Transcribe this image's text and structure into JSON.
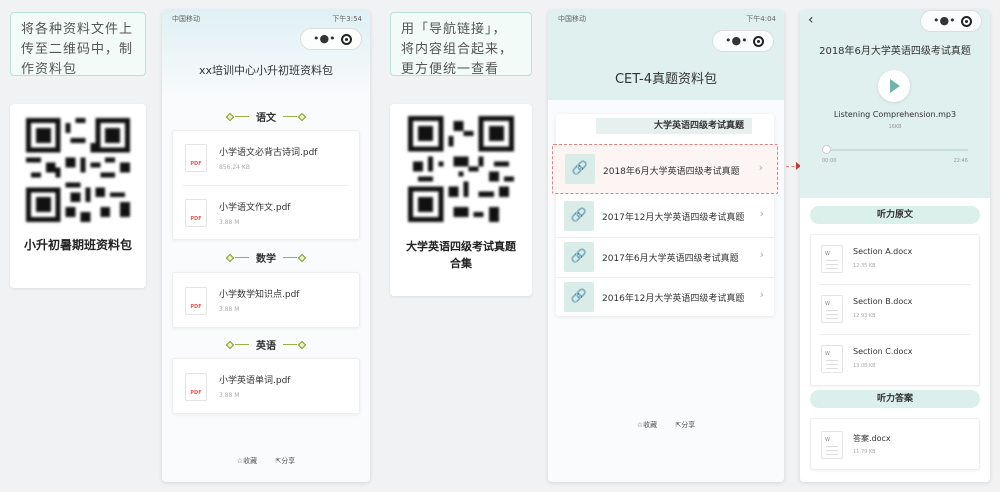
{
  "note1": {
    "lines": [
      "将各种资料文件上",
      "传至二维码中，制",
      "作资料包"
    ]
  },
  "qr1": {
    "caption": "小升初暑期班资料包"
  },
  "phone1": {
    "status_left": "中国移动",
    "status_right": "下午3:54",
    "title": "xx培训中心小升初班资料包",
    "sections": [
      {
        "name": "语文",
        "files": [
          {
            "name": "小学语文必背古诗词.pdf",
            "size": "856.24 KB"
          },
          {
            "name": "小学语文作文.pdf",
            "size": "3.88 M"
          }
        ]
      },
      {
        "name": "数学",
        "files": [
          {
            "name": "小学数学知识点.pdf",
            "size": "3.88 M"
          }
        ]
      },
      {
        "name": "英语",
        "files": [
          {
            "name": "小学英语单词.pdf",
            "size": "3.88 M"
          }
        ]
      }
    ],
    "icon_label": "PDF",
    "collect": "收藏",
    "share": "分享"
  },
  "note2": {
    "lines": [
      "用「导航链接」，",
      "将内容组合起来，",
      "更方便统一查看"
    ]
  },
  "qr2": {
    "caption_line1": "大学英语四级考试真题",
    "caption_line2": "合集"
  },
  "phone2": {
    "status_left": "中国移动",
    "status_right": "下午4:04",
    "title": "CET-4真题资料包",
    "tab_label": "大学英语四级考试真题",
    "links": [
      "2018年6月大学英语四级考试真题",
      "2017年12月大学英语四级考试真题",
      "2017年6月大学英语四级考试真题",
      "2016年12月大学英语四级考试真题"
    ],
    "collect": "收藏",
    "share": "分享"
  },
  "phone3": {
    "title": "2018年6月大学英语四级考试真题",
    "audio_name": "Listening Comprehension.mp3",
    "audio_size": "16KB",
    "time_start": "00:00",
    "time_end": "22:46",
    "section1": "听力原文",
    "files1": [
      {
        "name": "Section A.docx",
        "size": "12.35 KB"
      },
      {
        "name": "Section B.docx",
        "size": "12.93 KB"
      },
      {
        "name": "Section C.docx",
        "size": "13.08 KB"
      }
    ],
    "section2": "听力答案",
    "files2": [
      {
        "name": "答案.docx",
        "size": "11.79 KB"
      }
    ],
    "doc_label": "W"
  },
  "colors": {
    "accent": "#d9ece8",
    "header_bg": "#dff0ee",
    "highlight_border": "#e08080"
  }
}
